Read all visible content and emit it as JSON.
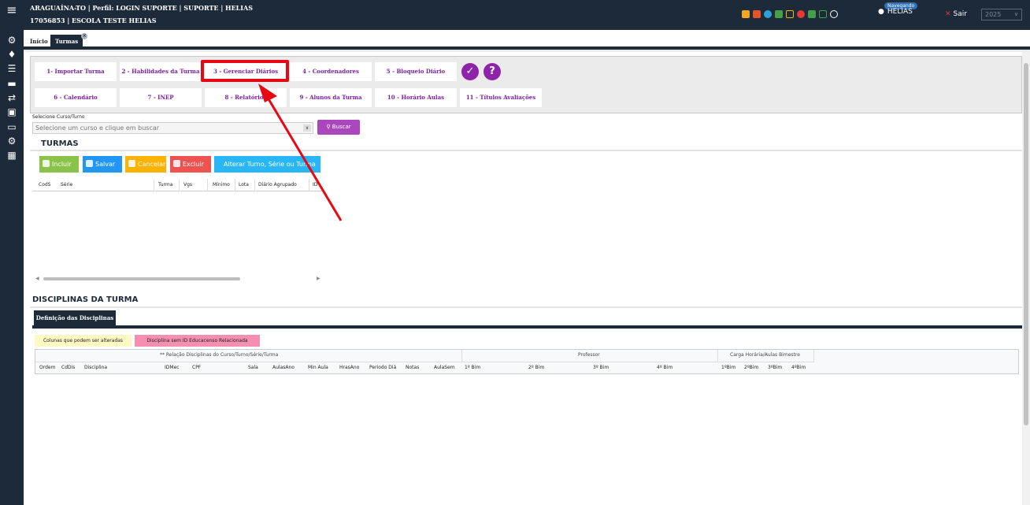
{
  "header": {
    "line1": "ARAGUAÍNA-TO | Perfil: LOGIN SUPORTE | SUPORTE | HELIAS",
    "line2": "17056853 | ESCOLA TESTE HELIAS",
    "nav_badge": "Navegando",
    "user_name": "HELIAS",
    "logout_label": "Sair",
    "year": "2025",
    "icons": [
      "envelope-icon",
      "chart-icon",
      "pie-icon",
      "chat-icon",
      "expand-icon",
      "close-circle-icon",
      "print-icon",
      "table-icon",
      "whatsapp-icon"
    ]
  },
  "tabs": [
    {
      "label": "Início"
    },
    {
      "label": "Turmas"
    }
  ],
  "menu_buttons": {
    "b1": "1- Importar Turma",
    "b2": "2 - Habilidades da Turma",
    "b3": "3 - Gerenciar Diários",
    "b4": "4 - Coordenadores",
    "b5": "5 - Bloqueio Diário",
    "b6": "6 - Calendário",
    "b7": "7 - INEP",
    "b8": "8 - Relatórios",
    "b9": "9 - Alunos da Turma",
    "b10": "10 - Horário Aulas",
    "b11": "11 - Títulos Avaliações"
  },
  "filter": {
    "label": "Selecione Curso/Turno",
    "placeholder": "Selecione um curso e clique em buscar",
    "search_label": "Buscar"
  },
  "turmas": {
    "title": "TURMAS",
    "actions": {
      "incluir": "Incluir",
      "salvar": "Salvar",
      "cancelar": "Cancelar",
      "excluir": "Excluir",
      "alterar": "Alterar Turno, Série ou Turma"
    },
    "columns": [
      "CodS",
      "Série",
      "Turma",
      "Vgs",
      "Mínimo",
      "Lota",
      "Diário Agrupado",
      "ID"
    ]
  },
  "disciplinas": {
    "title": "DISCIPLINAS DA TURMA",
    "subtab": "Definição das Disciplinas",
    "legend_editable": "Colunas que podem ser alteradas",
    "legend_no_id": "Disciplina sem ID Educacenso Relacionada",
    "group_relacao": "** Relação Disciplinas do Curso/Turno/Série/Turma",
    "group_professor": "Professor",
    "group_carga": "Carga Horária/Aulas Bimestre",
    "columns": [
      "Ordem",
      "CdDis",
      "Disciplina",
      "IDMec",
      "CPF",
      "Sala",
      "AulasAno",
      "Min Aula",
      "HrasAno",
      "Periodo Diá",
      "Notas",
      "AulaSem",
      "1º Bim",
      "2º Bim",
      "3º Bim",
      "4º Bim",
      "1ºBim",
      "2ºBim",
      "3ºBim",
      "4ºBim"
    ]
  },
  "colors": {
    "dark": "#1d2a3a",
    "purple": "#8e24aa",
    "highlight": "#e50914",
    "green": "#8bc34a",
    "blue": "#2196f3",
    "orange": "#ffb300",
    "red": "#ef5350",
    "cyan": "#29b6f6"
  }
}
